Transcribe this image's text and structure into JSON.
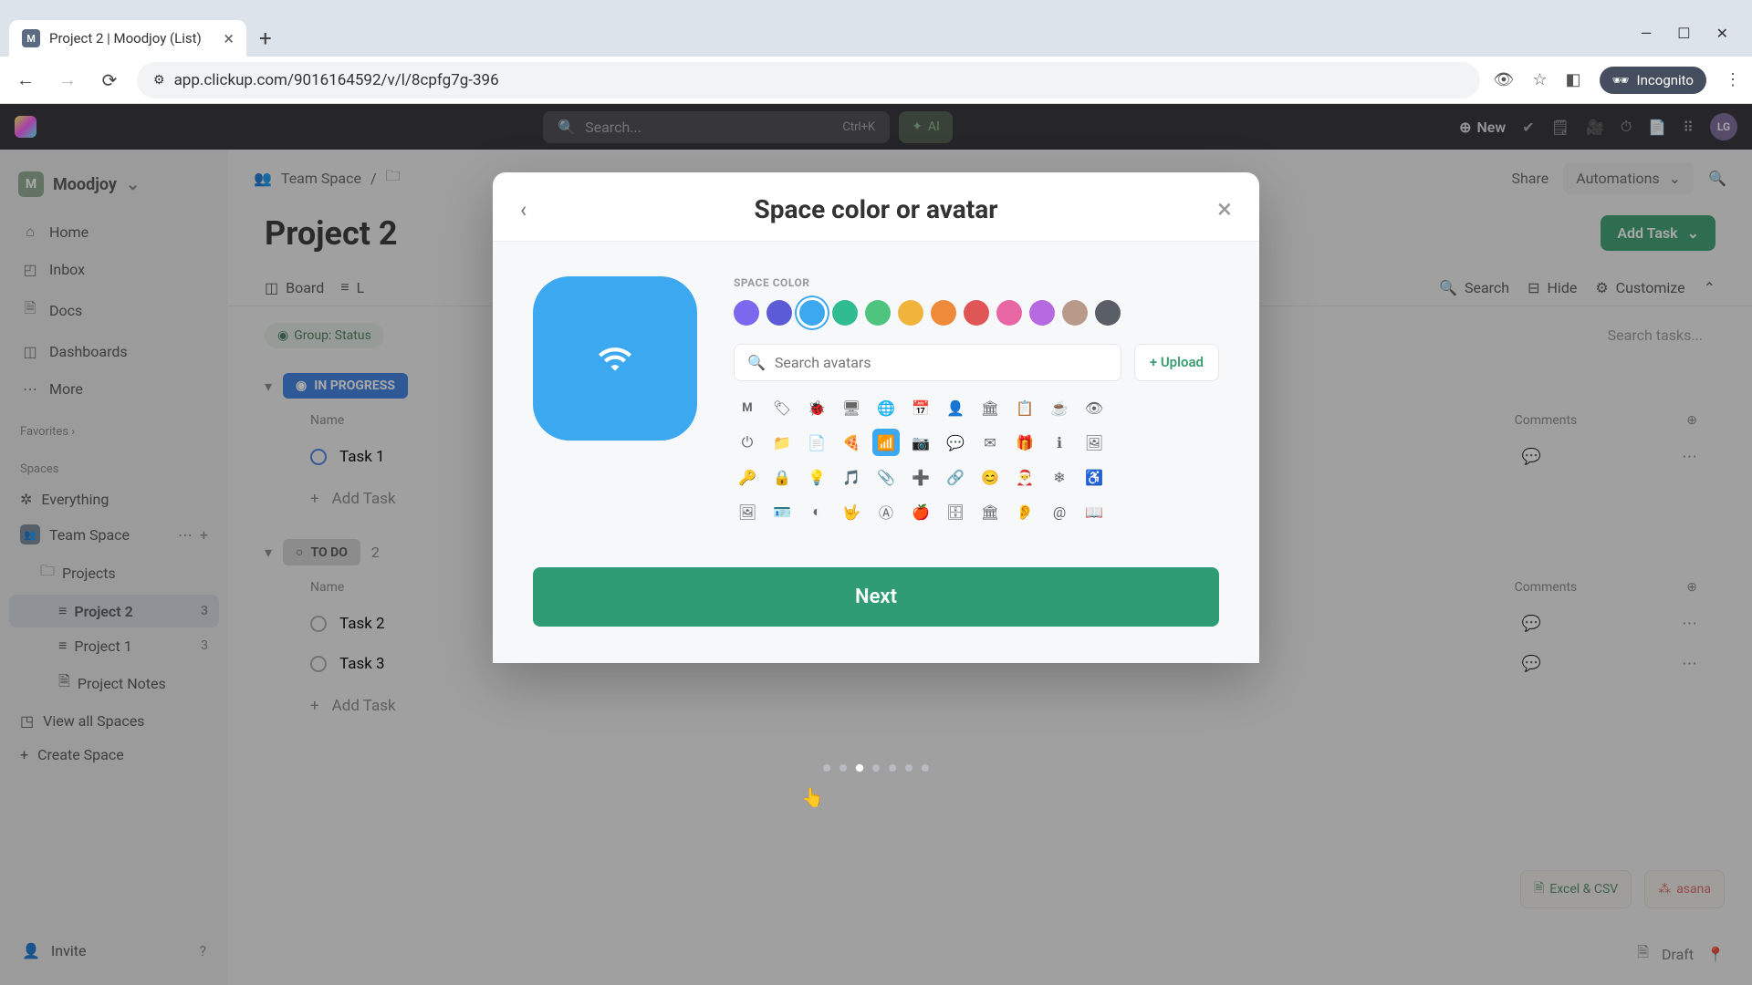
{
  "browser": {
    "tab_title": "Project 2 | Moodjoy (List)",
    "tab_initial": "M",
    "url": "app.clickup.com/9016164592/v/l/8cpfg7g-396",
    "incognito_label": "Incognito"
  },
  "appbar": {
    "search_placeholder": "Search...",
    "shortcut": "Ctrl+K",
    "ai_label": "AI",
    "new_label": "New",
    "avatar_initials": "LG"
  },
  "sidebar": {
    "workspace_initial": "M",
    "workspace_name": "Moodjoy",
    "nav": {
      "home": "Home",
      "inbox": "Inbox",
      "docs": "Docs",
      "dashboards": "Dashboards",
      "more": "More"
    },
    "favorites_label": "Favorites",
    "spaces_label": "Spaces",
    "everything": "Everything",
    "team_space": "Team Space",
    "projects": "Projects",
    "project2": {
      "name": "Project 2",
      "count": "3"
    },
    "project1": {
      "name": "Project 1",
      "count": "3"
    },
    "project_notes": "Project Notes",
    "view_all": "View all Spaces",
    "create_space": "Create Space",
    "invite": "Invite"
  },
  "board": {
    "breadcrumb_team": "Team Space",
    "share": "Share",
    "automations": "Automations",
    "title": "Project 2",
    "tabs": {
      "board": "Board",
      "list_initial": "L"
    },
    "toolbar": {
      "search": "Search",
      "hide": "Hide",
      "customize": "Customize"
    },
    "add_task": "Add Task",
    "group_status": "Group: Status",
    "search_tasks_placeholder": "Search tasks...",
    "cols": {
      "name": "Name",
      "comments": "Comments"
    },
    "groups": {
      "in_progress": {
        "label": "IN PROGRESS",
        "tasks": [
          "Task 1"
        ]
      },
      "todo": {
        "label": "TO DO",
        "count": "2",
        "tasks": [
          "Task 2",
          "Task 3"
        ]
      }
    },
    "add_task_inline": "Add Task"
  },
  "modal": {
    "title": "Space color or avatar",
    "color_label": "SPACE COLOR",
    "colors": [
      "#7b68ee",
      "#5b5bd6",
      "#3ba8ef",
      "#2fbc8f",
      "#4fc47f",
      "#f0b43c",
      "#ee8a3a",
      "#e05555",
      "#e866a3",
      "#b66ae0",
      "#b89a8a",
      "#5a5e66"
    ],
    "selected_color_index": 2,
    "search_placeholder": "Search avatars",
    "upload_label": "+ Upload",
    "next_label": "Next",
    "step_dots_total": 7,
    "step_dots_active": 2,
    "icon_grid_letter": "M"
  },
  "footer": {
    "excel": "Excel & CSV",
    "asana": "asana",
    "draft": "Draft"
  }
}
